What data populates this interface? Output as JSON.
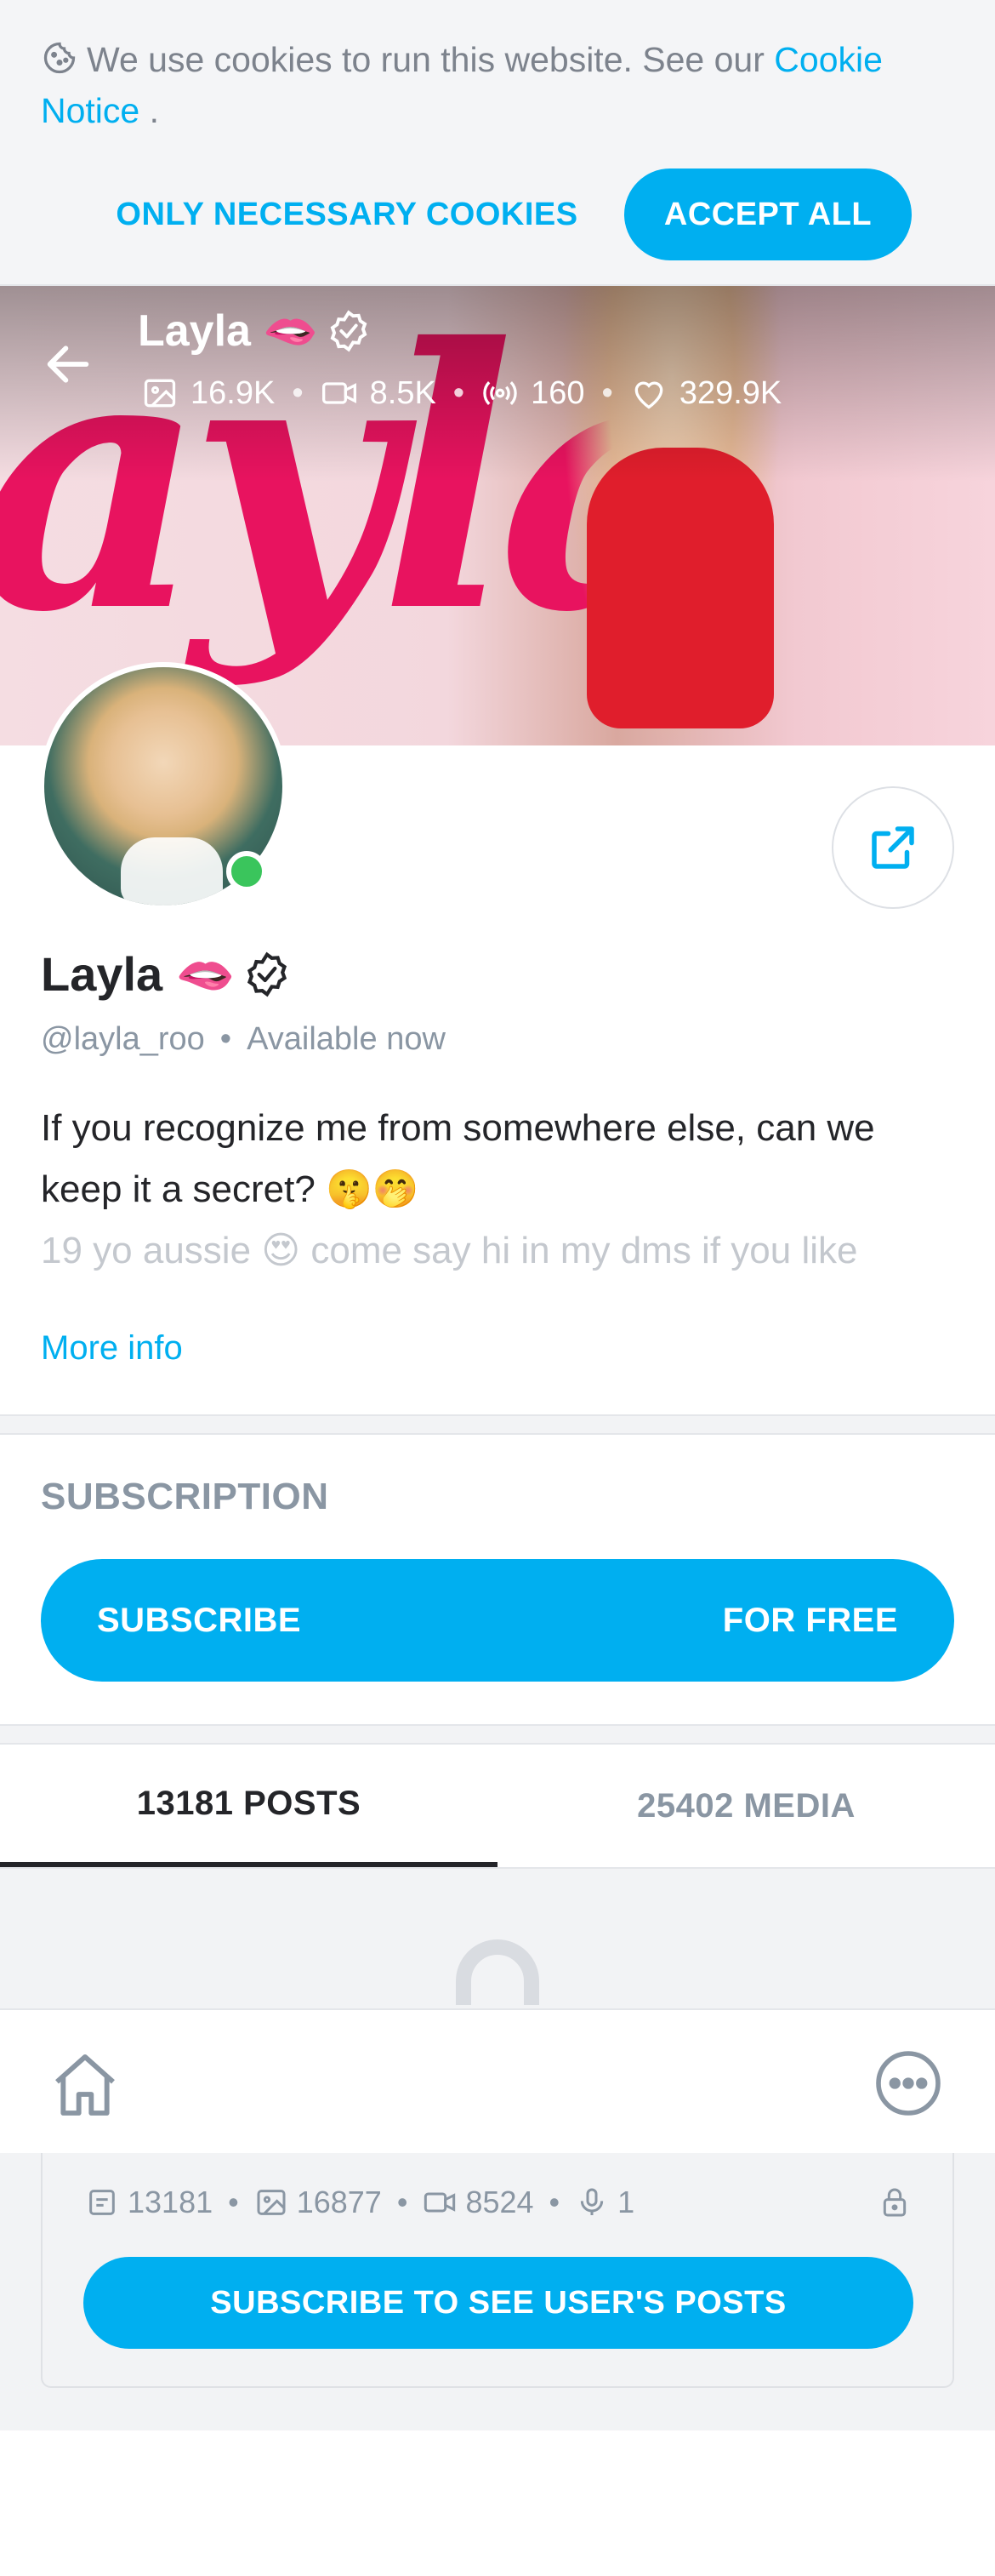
{
  "cookie": {
    "text": "We use cookies to run this website. See our",
    "link_text": "Cookie Notice",
    "trailing": " .",
    "necessary_label": "ONLY NECESSARY COOKIES",
    "accept_label": "ACCEPT ALL"
  },
  "header": {
    "name": "Layla 🫦",
    "stats": {
      "photos": "16.9K",
      "videos": "8.5K",
      "streams": "160",
      "likes": "329.9K"
    }
  },
  "profile": {
    "name": "Layla 🫦",
    "handle": "@layla_roo",
    "separator": "•",
    "status": "Available now",
    "bio_line1": "If you recognize me from somewhere else, can we keep it a secret? 🤫🤭",
    "bio_line2": "19 yo aussie 😍 come say hi in my dms if you like",
    "more_info": "More info"
  },
  "subscription": {
    "title": "SUBSCRIPTION",
    "button_left": "SUBSCRIBE",
    "button_right": "FOR FREE"
  },
  "tabs": [
    {
      "label": "13181 POSTS",
      "active": true
    },
    {
      "label": "25402 MEDIA",
      "active": false
    }
  ],
  "locked": {
    "posts": "13181",
    "photos": "16877",
    "videos": "8524",
    "audio": "1",
    "button": "SUBSCRIBE TO SEE USER'S POSTS"
  },
  "colors": {
    "accent": "#00aff0",
    "online": "#3ac55c",
    "muted": "#8a96a3"
  },
  "icons": [
    "cookie-icon",
    "back-arrow-icon",
    "verified-icon",
    "image-icon",
    "video-icon",
    "stream-icon",
    "heart-icon",
    "share-icon",
    "lock-icon",
    "home-icon",
    "more-icon",
    "post-icon",
    "mic-icon"
  ]
}
